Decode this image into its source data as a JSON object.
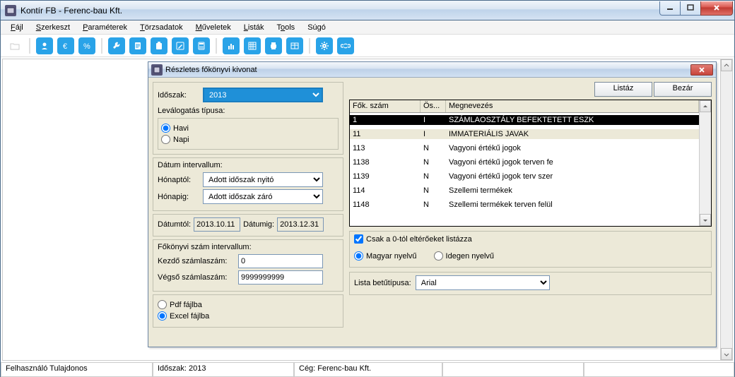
{
  "window": {
    "title": "Kontír FB  - Ferenc-bau Kft."
  },
  "menus": {
    "file": "Fájl",
    "edit": "Szerkeszt",
    "params": "Paraméterek",
    "master": "Törzsadatok",
    "ops": "Műveletek",
    "lists": "Listák",
    "tools": "Tools",
    "help": "Súgó"
  },
  "status": {
    "user": "Felhasználó Tulajdonos",
    "period": "Időszak: 2013",
    "company": "Cég: Ferenc-bau Kft."
  },
  "dialog": {
    "title": "Részletes főkönyvi kivonat",
    "btn_list": "Listáz",
    "btn_close": "Bezár",
    "period_label": "Időszak:",
    "period_value": "2013",
    "filter_type_label": "Leválogatás típusa:",
    "filter_monthly": "Havi",
    "filter_daily": "Napi",
    "date_interval_label": "Dátum intervallum:",
    "month_from_label": "Hónaptól:",
    "month_from_value": "Adott időszak nyitó",
    "month_to_label": "Hónapig:",
    "month_to_value": "Adott időszak záró",
    "date_from_label": "Dátumtól:",
    "date_from_value": "2013.10.11",
    "date_to_label": "Dátumig:",
    "date_to_value": "2013.12.31",
    "account_interval_label": "Főkönyvi szám intervallum:",
    "account_from_label": "Kezdő számlaszám:",
    "account_from_value": "0",
    "account_to_label": "Végső számlaszám:",
    "account_to_value": "9999999999",
    "output_pdf": "Pdf fájlba",
    "output_excel": "Excel fájlba",
    "only_nonzero": "Csak a 0-tól eltérőeket listázza",
    "lang_hu": "Magyar nyelvű",
    "lang_foreign": "Idegen nyelvű",
    "font_label": "Lista betűtípusa:",
    "font_value": "Arial",
    "grid_headers": {
      "col1": "Fők. szám",
      "col2": "Ös...",
      "col3": "Megnevezés"
    },
    "grid_rows": [
      {
        "num": "1",
        "sum": "I",
        "name": "SZÁMLAOSZTÁLY BEFEKTETETT ESZK",
        "sel": "sel"
      },
      {
        "num": "11",
        "sum": "I",
        "name": "IMMATERIÁLIS JAVAK",
        "sel": "sel2"
      },
      {
        "num": "113",
        "sum": "N",
        "name": "Vagyoni értékű jogok",
        "sel": ""
      },
      {
        "num": "1138",
        "sum": "N",
        "name": "Vagyoni értékű jogok terven fe",
        "sel": ""
      },
      {
        "num": "1139",
        "sum": "N",
        "name": "Vagyoni értékű jogok terv szer",
        "sel": ""
      },
      {
        "num": "114",
        "sum": "N",
        "name": "Szellemi termékek",
        "sel": ""
      },
      {
        "num": "1148",
        "sum": "N",
        "name": "Szellemi termékek terven felül",
        "sel": ""
      }
    ]
  }
}
